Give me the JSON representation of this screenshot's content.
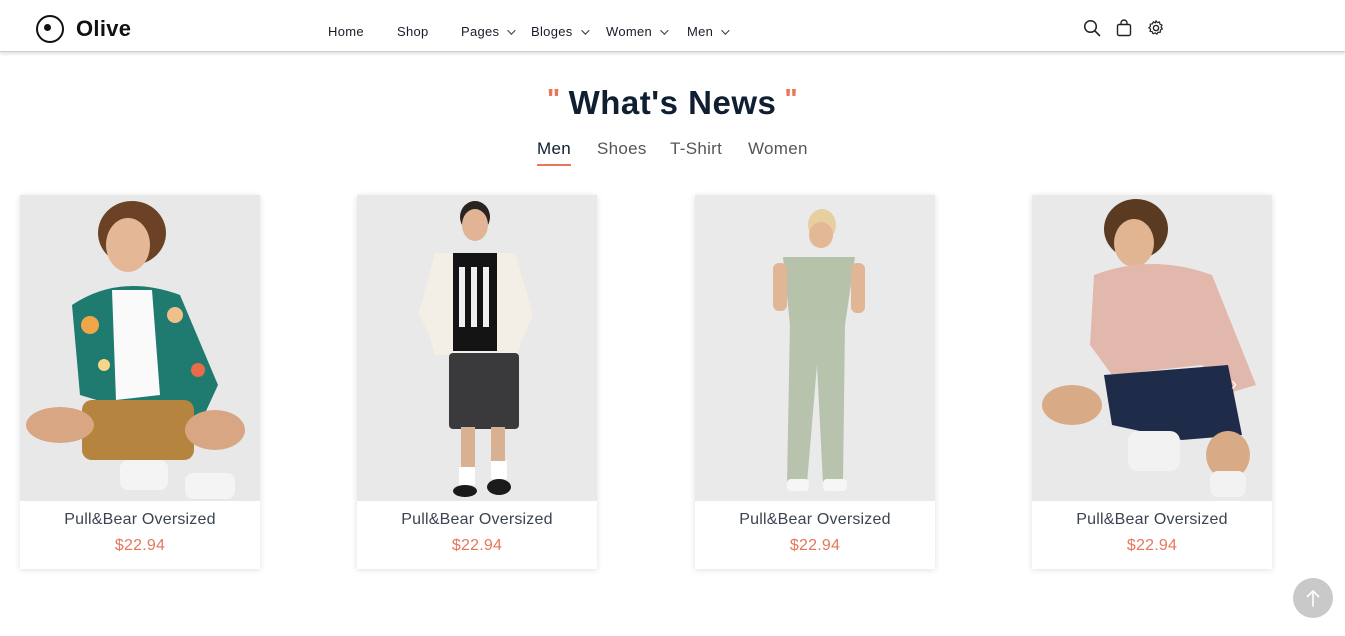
{
  "brand": {
    "name": "Olive"
  },
  "nav": [
    {
      "label": "Home",
      "has_dropdown": false
    },
    {
      "label": "Shop",
      "has_dropdown": false
    },
    {
      "label": "Pages",
      "has_dropdown": true
    },
    {
      "label": "Bloges",
      "has_dropdown": true
    },
    {
      "label": "Women",
      "has_dropdown": true
    },
    {
      "label": "Men",
      "has_dropdown": true
    }
  ],
  "header_icons": [
    "search-icon",
    "shopping-bag-icon",
    "settings-gear-icon"
  ],
  "section": {
    "quote_open": "\"",
    "title": "What's News",
    "quote_close": "\""
  },
  "tabs": [
    {
      "label": "Men",
      "active": true
    },
    {
      "label": "Shoes",
      "active": false
    },
    {
      "label": "T-Shirt",
      "active": false
    },
    {
      "label": "Women",
      "active": false
    }
  ],
  "products": [
    {
      "name": "Pull&Bear Oversized",
      "price": "$22.94",
      "image": "man-in-floral-shirt-crouching"
    },
    {
      "name": "Pull&Bear Oversized",
      "price": "$22.94",
      "image": "man-in-white-jacket-standing"
    },
    {
      "name": "Pull&Bear Oversized",
      "price": "$22.94",
      "image": "man-in-sage-outfit-back-view"
    },
    {
      "name": "Pull&Bear Oversized",
      "price": "$22.94",
      "image": "man-in-pink-tee-crouching"
    }
  ],
  "colors": {
    "accent": "#e8765a",
    "title": "#0f1e30",
    "image_bg": "#e9e9ea",
    "to_top_bg": "#c9c9c9"
  }
}
